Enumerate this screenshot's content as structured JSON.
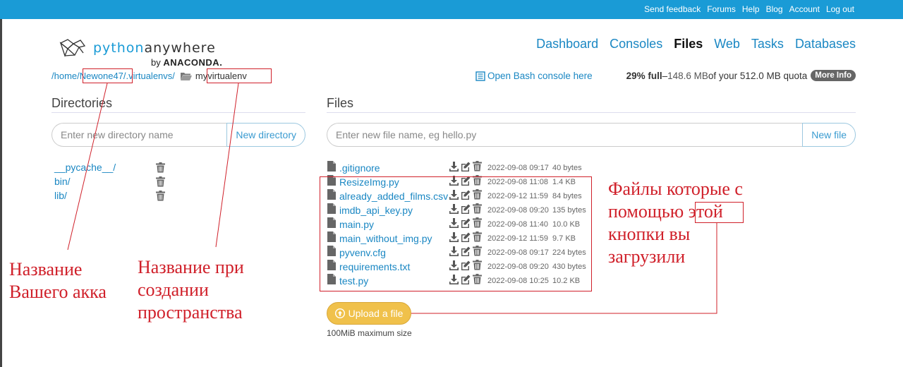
{
  "topbar": {
    "links": [
      "Send feedback",
      "Forums",
      "Help",
      "Blog",
      "Account",
      "Log out"
    ]
  },
  "logo": {
    "python": "python",
    "anywhere": "anywhere",
    "by": "by",
    "anaconda": "ANACONDA."
  },
  "nav": {
    "items": [
      "Dashboard",
      "Consoles",
      "Files",
      "Web",
      "Tasks",
      "Databases"
    ],
    "active": "Files"
  },
  "breadcrumb": {
    "home": "/home/",
    "user": "Newone47",
    "sep1": "/",
    "virtualenvs": ".virtualenvs/",
    "current": "myvirtualenv"
  },
  "bash_link": "Open Bash console here",
  "quota": {
    "pct": "29% full",
    "dash": " – ",
    "used": "148.6 MB",
    "of": " of your 512.0 MB quota",
    "more_info": "More Info"
  },
  "directories": {
    "title": "Directories",
    "input_placeholder": "Enter new directory name",
    "button": "New directory",
    "items": [
      "__pycache__/",
      "bin/",
      "lib/"
    ]
  },
  "files": {
    "title": "Files",
    "input_placeholder": "Enter new file name, eg hello.py",
    "button": "New file",
    "items": [
      {
        "name": ".gitignore",
        "date": "2022-09-08 09:17",
        "size": "40 bytes"
      },
      {
        "name": "ResizeImg.py",
        "date": "2022-09-08 11:08",
        "size": "1.4 KB"
      },
      {
        "name": "already_added_films.csv",
        "date": "2022-09-12 11:59",
        "size": "84 bytes"
      },
      {
        "name": "imdb_api_key.py",
        "date": "2022-09-08 09:20",
        "size": "135 bytes"
      },
      {
        "name": "main.py",
        "date": "2022-09-08 11:40",
        "size": "10.0 KB"
      },
      {
        "name": "main_without_img.py",
        "date": "2022-09-12 11:59",
        "size": "9.7 KB"
      },
      {
        "name": "pyvenv.cfg",
        "date": "2022-09-08 09:17",
        "size": "224 bytes"
      },
      {
        "name": "requirements.txt",
        "date": "2022-09-08 09:20",
        "size": "430 bytes"
      },
      {
        "name": "test.py",
        "date": "2022-09-08 10:25",
        "size": "10.2 KB"
      }
    ]
  },
  "upload": {
    "button": "Upload a file",
    "note": "100MiB maximum size"
  },
  "annotations": {
    "account": [
      "Название",
      "Вашего акка"
    ],
    "space": [
      "Название при",
      "создании",
      "пространства"
    ],
    "files": [
      "Файлы которые с",
      "помощью",
      "этой",
      "кнопки вы",
      "загрузили"
    ]
  },
  "colors": {
    "topbar": "#1a9bd6",
    "link": "#1a87c3",
    "upload": "#f0c14b",
    "annotation": "#d0202a"
  }
}
